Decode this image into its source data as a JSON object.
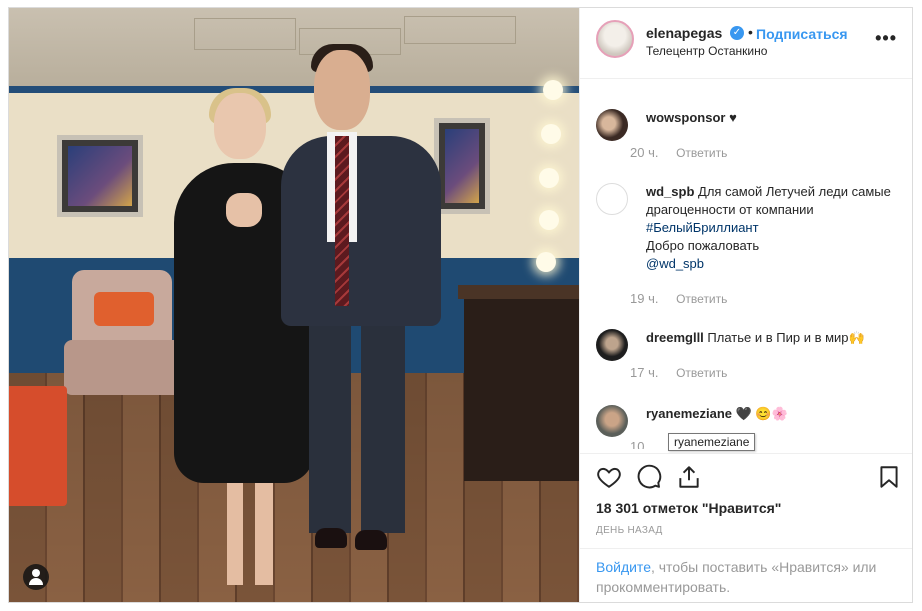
{
  "post": {
    "username": "elenapegas",
    "follow_label": "Подписаться",
    "separator": "•",
    "location": "Телецентр Останкино",
    "more_label": "•••"
  },
  "comments": [
    {
      "username": "wowsponsor",
      "text": "♥",
      "time": "20 ч.",
      "reply": "Ответить"
    },
    {
      "username": "wd_spb",
      "text": "Для самой Летучей леди самые драгоценности от компании",
      "hashtag": "#БелыйБриллиант",
      "text2": "Добро пожаловать",
      "mention": "@wd_spb",
      "time": "19 ч.",
      "reply": "Ответить"
    },
    {
      "username": "dreemglll",
      "text": "Платье и в Пир и в мир🙌",
      "time": "17 ч.",
      "reply": "Ответить"
    },
    {
      "username": "ryanemeziane",
      "text": "🖤 😊🌸",
      "time": "10",
      "reply": ""
    }
  ],
  "tooltip": "ryanemeziane",
  "likes": "18 301 отметок \"Нравится\"",
  "timestamp": "ДЕНЬ НАЗАД",
  "login": {
    "link": "Войдите",
    "text": ", чтобы поставить «Нравится» или прокомментировать."
  },
  "icons": [
    "heart-icon",
    "comment-icon",
    "share-icon",
    "bookmark-icon",
    "user-tag-icon",
    "more-icon"
  ],
  "colors": {
    "accent": "#3897f0",
    "border": "#dbdbdb",
    "muted": "#999999"
  }
}
